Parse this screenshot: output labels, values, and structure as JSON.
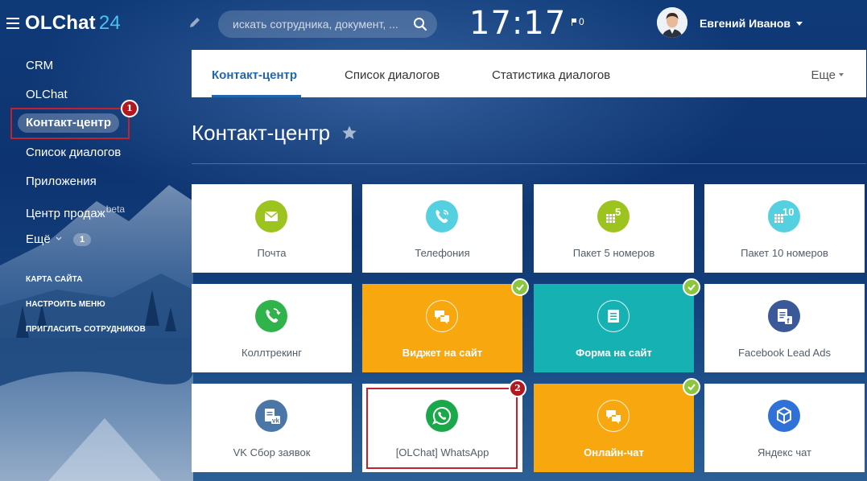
{
  "app": {
    "logo_text": "OLChat",
    "logo_number": "24"
  },
  "header": {
    "search_placeholder": "искать сотрудника, документ, ...",
    "clock": "17:17",
    "flag_count": "0",
    "user_name": "Евгений Иванов"
  },
  "sidebar": {
    "items": [
      {
        "label": "CRM"
      },
      {
        "label": "OLChat"
      },
      {
        "label": "Контакт-центр",
        "active": true
      },
      {
        "label": "Список диалогов"
      },
      {
        "label": "Приложения"
      },
      {
        "label": "Центр продаж",
        "sup": "beta"
      },
      {
        "label": "Ещё",
        "badge": "1"
      }
    ],
    "links": [
      "КАРТА САЙТА",
      "НАСТРОИТЬ МЕНЮ",
      "ПРИГЛАСИТЬ СОТРУДНИКОВ"
    ],
    "annotation_number": "1"
  },
  "tabs": {
    "items": [
      "Контакт-центр",
      "Список диалогов",
      "Статистика диалогов"
    ],
    "more": "Еще"
  },
  "page": {
    "title": "Контакт-центр"
  },
  "tiles": [
    {
      "label": "Почта",
      "icon": "mail-icon",
      "color": "#9dc31e"
    },
    {
      "label": "Телефония",
      "icon": "phone-icon",
      "color": "#55d0e0"
    },
    {
      "label": "Пакет 5 номеров",
      "icon": "dialpad-5-icon",
      "color": "#9dc31e",
      "icon_text": "5"
    },
    {
      "label": "Пакет 10 номеров",
      "icon": "dialpad-10-icon",
      "color": "#55d0e0",
      "icon_text": "10"
    },
    {
      "label": "Коллтрекинг",
      "icon": "calltracking-icon",
      "color": "#2fb34a"
    },
    {
      "label": "Виджет на сайт",
      "icon": "widget-chat-icon",
      "color": "#f8a70f",
      "active": true
    },
    {
      "label": "Форма на сайт",
      "icon": "form-icon",
      "color": "#16b1b3",
      "active": true
    },
    {
      "label": "Facebook Lead Ads",
      "icon": "facebook-leads-icon",
      "color": "#3b5998"
    },
    {
      "label": "VK Сбор заявок",
      "icon": "vk-leads-icon",
      "color": "#4a76a8"
    },
    {
      "label": "[OLChat] WhatsApp",
      "icon": "whatsapp-icon",
      "color": "#1ba84a"
    },
    {
      "label": "Онлайн-чат",
      "icon": "online-chat-icon",
      "color": "#f8a70f",
      "active": true
    },
    {
      "label": "Яндекс чат",
      "icon": "yandex-chat-icon",
      "color": "#3071d7"
    }
  ],
  "annotation2_number": "2"
}
